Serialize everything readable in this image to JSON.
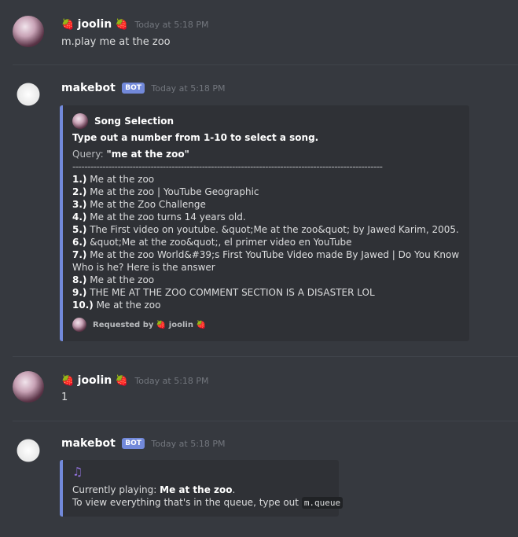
{
  "messages": [
    {
      "author": "joolin",
      "prefix": "🍓",
      "suffix": "🍓",
      "timestamp": "Today at 5:18 PM",
      "text": "m.play me at the zoo"
    },
    {
      "author": "makebot",
      "tag": "BOT",
      "timestamp": "Today at 5:18 PM",
      "embed": {
        "author": "Song Selection",
        "title": "Type out a number from 1-10 to select a song.",
        "query_label": "Query:",
        "query_value": "\"me at the zoo\"",
        "separator": "-------------------------------------------------------------------------------------------------------",
        "results": [
          {
            "num": "1.)",
            "text": "Me at the zoo"
          },
          {
            "num": "2.)",
            "text": "Me at the zoo | YouTube Geographic"
          },
          {
            "num": "3.)",
            "text": "Me at the Zoo Challenge"
          },
          {
            "num": "4.)",
            "text": "Me at the zoo turns 14 years old."
          },
          {
            "num": "5.)",
            "text": "The First video on youtube. &quot;Me at the zoo&quot; by Jawed Karim, 2005."
          },
          {
            "num": "6.)",
            "text": "&quot;Me at the zoo&quot;, el primer video en YouTube"
          },
          {
            "num": "7.)",
            "text": "Me at the zoo World&#39;s First YouTube Video made By Jawed | Do You Know Who is he? Here is the answer"
          },
          {
            "num": "8.)",
            "text": "Me at the zoo"
          },
          {
            "num": "9.)",
            "text": "THE ME AT THE ZOO COMMENT SECTION IS A DISASTER LOL"
          },
          {
            "num": "10.)",
            "text": "Me at the zoo"
          }
        ],
        "footer_label": "Requested by",
        "footer_prefix": "🍓",
        "footer_user": "joolin",
        "footer_suffix": "🍓"
      }
    },
    {
      "author": "joolin",
      "prefix": "🍓",
      "suffix": "🍓",
      "timestamp": "Today at 5:18 PM",
      "text": "1"
    },
    {
      "author": "makebot",
      "tag": "BOT",
      "timestamp": "Today at 5:18 PM",
      "embed": {
        "icon": "music-note-icon",
        "playing_label": "Currently playing:",
        "playing_value": "Me at the zoo",
        "playing_end": ".",
        "queue_text": "To view everything that's in the queue, type out",
        "queue_command": "m.queue"
      }
    }
  ],
  "colors": {
    "background": "#36393f",
    "embed_bg": "#2f3136",
    "accent": "#7289da",
    "timestamp": "#72767d"
  }
}
